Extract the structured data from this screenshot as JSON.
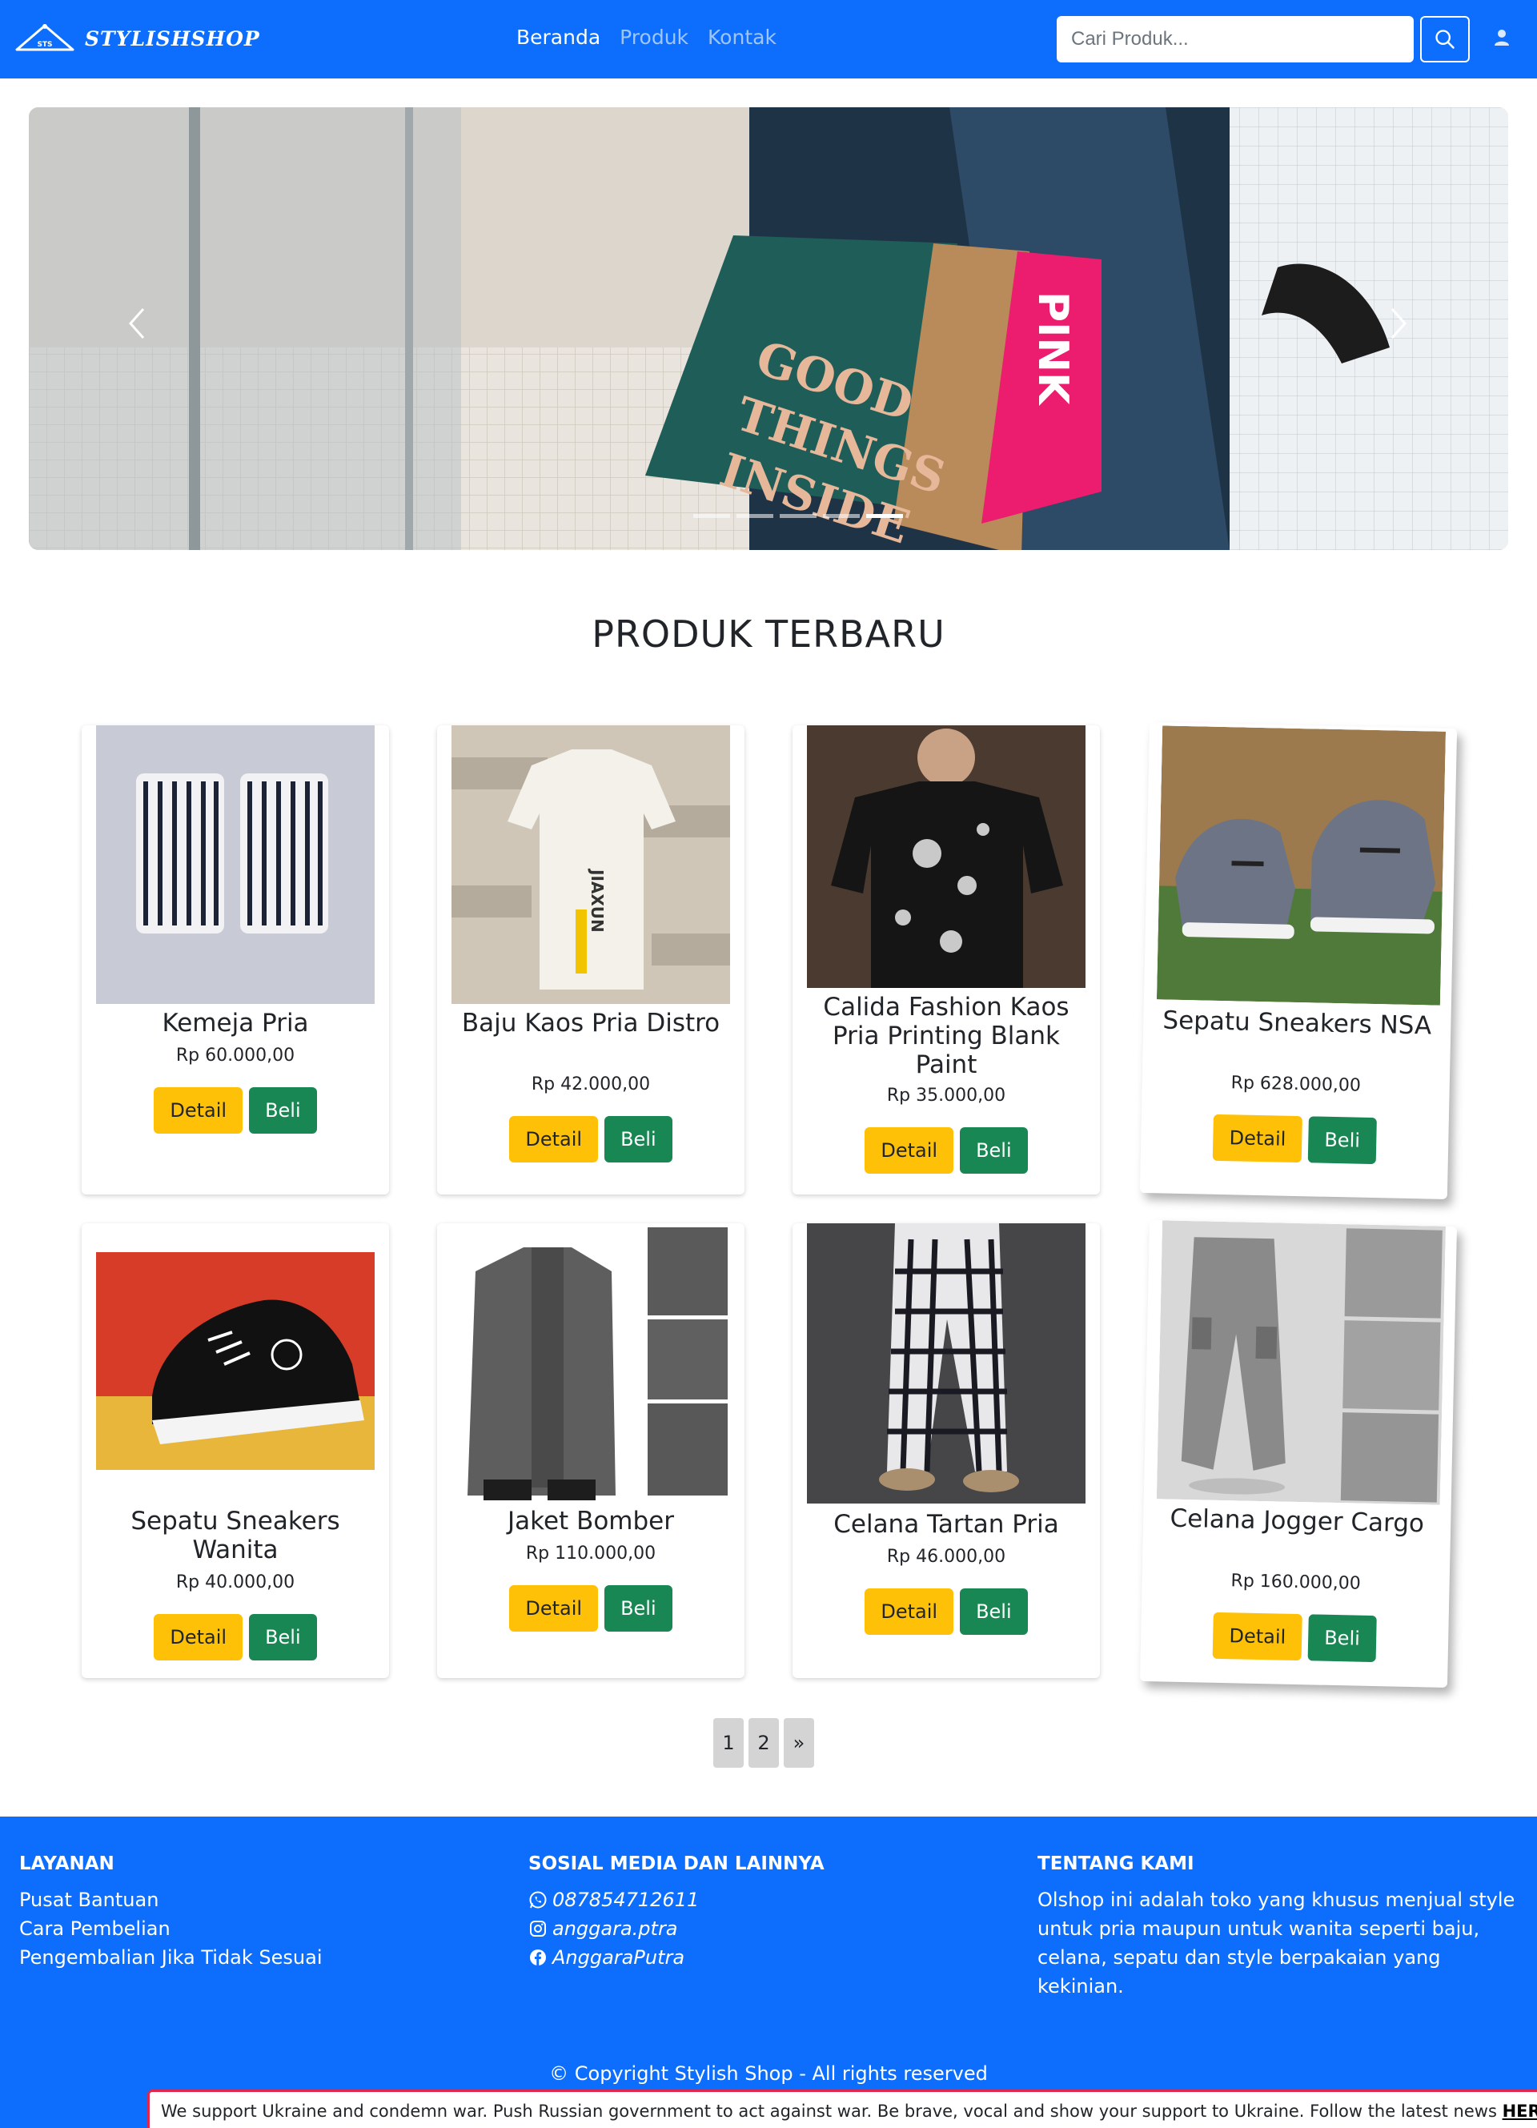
{
  "navbar": {
    "brand": "STYLISHSHOP",
    "links": [
      {
        "label": "Beranda",
        "active": true
      },
      {
        "label": "Produk",
        "active": false
      },
      {
        "label": "Kontak",
        "active": false
      }
    ],
    "search_placeholder": "Cari Produk...",
    "icons": [
      "hanger-logo-icon",
      "search-icon",
      "user-icon"
    ]
  },
  "carousel": {
    "slide_count": 5,
    "active_slide": 5,
    "bag_text": "GOOD THINGS INSIDE",
    "bag_text_pink": "PINK"
  },
  "section_title": "PRODUK TERBARU",
  "products": [
    {
      "name": "Kemeja Pria",
      "price": "Rp 60.000,00"
    },
    {
      "name": "Baju Kaos Pria Distro",
      "price": "Rp 42.000,00"
    },
    {
      "name": "Calida Fashion Kaos Pria Printing Blank Paint",
      "price": "Rp 35.000,00"
    },
    {
      "name": "Sepatu Sneakers NSA",
      "price": "Rp 628.000,00"
    },
    {
      "name": "Sepatu Sneakers Wanita",
      "price": "Rp 40.000,00"
    },
    {
      "name": "Jaket Bomber",
      "price": "Rp 110.000,00"
    },
    {
      "name": "Celana Tartan Pria",
      "price": "Rp 46.000,00"
    },
    {
      "name": "Celana Jogger Cargo",
      "price": "Rp 160.000,00"
    }
  ],
  "buttons": {
    "detail": "Detail",
    "beli": "Beli"
  },
  "pagination": [
    "1",
    "2",
    "»"
  ],
  "footer": {
    "layanan": {
      "title": "LAYANAN",
      "items": [
        "Pusat Bantuan",
        "Cara Pembelian",
        "Pengembalian Jika Tidak Sesuai"
      ]
    },
    "sosial": {
      "title": "SOSIAL MEDIA DAN LAINNYA",
      "items": [
        {
          "icon": "whatsapp-icon",
          "text": "087854712611"
        },
        {
          "icon": "instagram-icon",
          "text": "anggara.ptra"
        },
        {
          "icon": "facebook-icon",
          "text": "AnggaraPutra"
        }
      ]
    },
    "tentang": {
      "title": "TENTANG KAMI",
      "text": "Olshop ini adalah toko yang khusus menjual style untuk pria maupun untuk wanita seperti baju, celana, sepatu dan style berpakaian yang kekinian."
    },
    "copyright": "© Copyright Stylish Shop - All rights reserved"
  },
  "ukraine_bar": {
    "text": "We support Ukraine and condemn war. Push Russian government to act against war. Be brave, vocal and show your support to Ukraine. Follow the latest news",
    "link": "HERE"
  },
  "colors": {
    "primary": "#0d6efd",
    "warning": "#ffc107",
    "success": "#198754"
  }
}
